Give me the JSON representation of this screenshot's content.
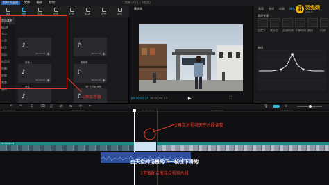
{
  "menubar": {
    "app_name": "剪映专业版",
    "items": [
      "文件",
      "编辑",
      "帮助"
    ]
  },
  "window_title": "剪映 (人) (上下左右)",
  "brand": {
    "name": "羽兔网",
    "sub": "yutu.cn"
  },
  "media_tabs": [
    {
      "label": "媒体",
      "icon": "media-icon"
    },
    {
      "label": "音频",
      "icon": "audio-icon"
    },
    {
      "label": "文本",
      "icon": "text-icon"
    },
    {
      "label": "贴纸",
      "icon": "sticker-icon"
    },
    {
      "label": "特效",
      "icon": "effects-icon"
    },
    {
      "label": "转场",
      "icon": "transition-icon"
    },
    {
      "label": "滤镜",
      "icon": "filter-icon"
    },
    {
      "label": "调节",
      "icon": "adjust-icon"
    }
  ],
  "categories": [
    "音乐素材",
    "BGM",
    "卡点",
    "人声",
    "抖音",
    "国风",
    "纯音乐",
    "伤感",
    "舒缓",
    "美食",
    "旅行"
  ],
  "cards": [
    {
      "title": "",
      "duration": "00:00:50"
    },
    {
      "title": "",
      "duration": "00:00:30"
    },
    {
      "title": "",
      "duration": "00:00:15"
    },
    {
      "title": "",
      "duration": "00:00:20"
    },
    {
      "title": "新版入",
      "duration": "00:00:42"
    },
    {
      "title": "唯美歌",
      "duration": "00:00:48"
    },
    {
      "title": "惯性",
      "duration": "00:00:34"
    },
    {
      "title": "\"啊\"又不起来的",
      "duration": "00:00:17"
    }
  ],
  "annotations": {
    "step1": "1添加音效",
    "step2": "2再次对视频天空片段调整",
    "step3": "3音效配合衔接点视频片段"
  },
  "player": {
    "title": "播放器",
    "current_time": "00:00:02:27",
    "total_time": "00:00:04:23"
  },
  "right_panel": {
    "tabs": [
      "画面",
      "变速",
      "动画",
      "调节"
    ],
    "active_tab": "调节",
    "section_label": "曲线",
    "speed_label": "常规变速",
    "labels": [
      "自定义",
      "蒙太奇",
      "英雄时刻",
      "子弹时间",
      "跳接",
      "闪进",
      "闪出"
    ]
  },
  "timeline": {
    "timecodes": [
      "00:00:00:00",
      "00:00:01:00",
      "00:00:02:00",
      "00:00:03:00",
      "00:00:04:00"
    ],
    "clip_label": "00:00:04:23"
  },
  "subtitle": "由天空的场景的下一帧往下滑的",
  "colors": {
    "accent": "#2ab8e8",
    "annotation": "#ff3b30",
    "audio_track": "#2f4f9a",
    "video_track": "#1aa7a0"
  }
}
